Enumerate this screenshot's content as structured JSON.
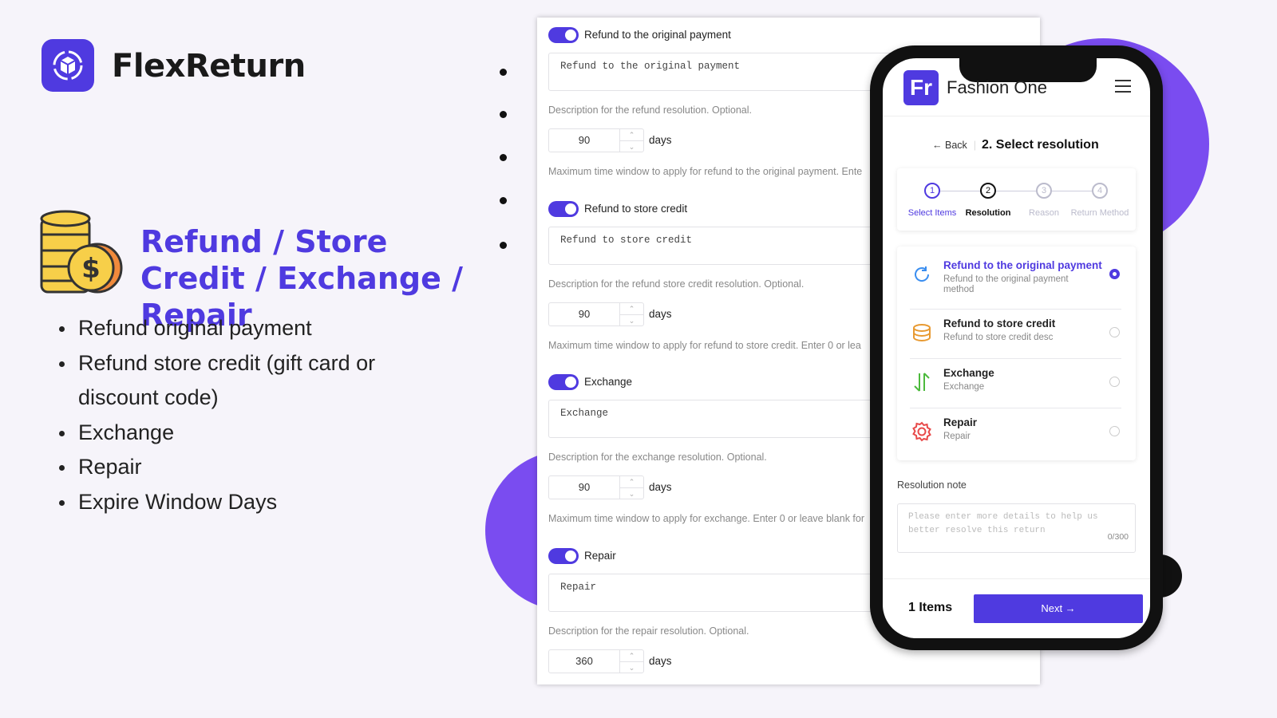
{
  "brand": {
    "name": "FlexReturn",
    "accent": "#4f3ae0"
  },
  "headline": "Refund / Store Credit / Exchange / Repair",
  "features": [
    "Refund original payment",
    "Refund store credit (gift card or discount code)",
    "Exchange",
    "Repair",
    "Expire Window Days"
  ],
  "admin": {
    "days_label": "days",
    "sections": [
      {
        "label": "Refund to the original payment",
        "enabled": true,
        "description": "Refund to the original payment",
        "description_help": "Description for the refund resolution. Optional.",
        "days": "90",
        "days_help": "Maximum time window to apply for refund to the original payment. Ente"
      },
      {
        "label": "Refund to store credit",
        "enabled": true,
        "description": "Refund to store credit",
        "description_help": "Description for the refund store credit resolution. Optional.",
        "days": "90",
        "days_help": "Maximum time window to apply for refund to store credit. Enter 0 or lea"
      },
      {
        "label": "Exchange",
        "enabled": true,
        "description": "Exchange",
        "description_help": "Description for the exchange resolution. Optional.",
        "days": "90",
        "days_help": "Maximum time window to apply for exchange. Enter 0 or leave blank for"
      },
      {
        "label": "Repair",
        "enabled": true,
        "description": "Repair",
        "description_help": "Description for the repair resolution. Optional.",
        "days": "360",
        "days_help": ""
      }
    ]
  },
  "phone": {
    "store_logo": "Fr",
    "store_name": "Fashion One",
    "back": "Back",
    "title": "2. Select resolution",
    "steps": [
      {
        "num": "1",
        "label": "Select Items",
        "state": "done"
      },
      {
        "num": "2",
        "label": "Resolution",
        "state": "current"
      },
      {
        "num": "3",
        "label": "Reason",
        "state": "todo"
      },
      {
        "num": "4",
        "label": "Return Method",
        "state": "todo"
      }
    ],
    "options": [
      {
        "title": "Refund to the original payment",
        "desc": "Refund to the original payment method",
        "icon": "refresh-icon",
        "selected": true
      },
      {
        "title": "Refund to store credit",
        "desc": "Refund to store credit desc",
        "icon": "coins-icon",
        "selected": false
      },
      {
        "title": "Exchange",
        "desc": "Exchange",
        "icon": "exchange-arrows-icon",
        "selected": false
      },
      {
        "title": "Repair",
        "desc": "Repair",
        "icon": "gear-icon",
        "selected": false
      }
    ],
    "note_label": "Resolution note",
    "note_placeholder": "Please enter more details to help us better resolve this return",
    "note_count": "0/300",
    "items": "1 Items",
    "next": "Next →"
  }
}
